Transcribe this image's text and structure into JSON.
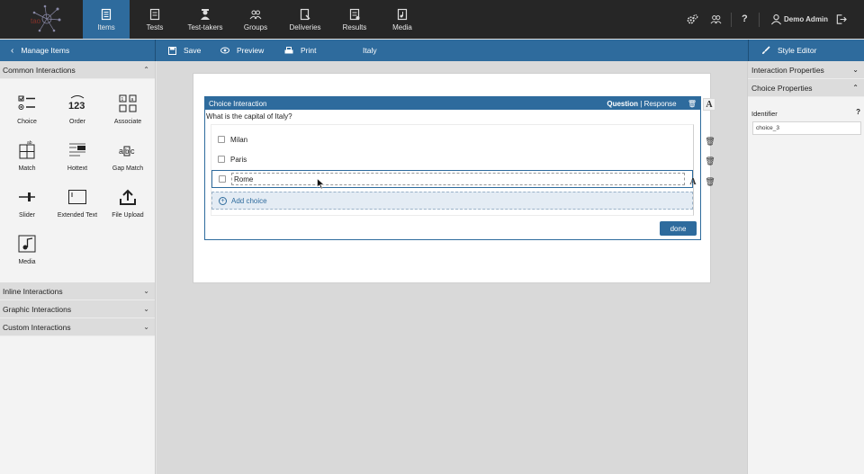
{
  "nav": {
    "tabs": [
      {
        "label": "Items",
        "icon": "items-icon",
        "active": true
      },
      {
        "label": "Tests",
        "icon": "tests-icon"
      },
      {
        "label": "Test-takers",
        "icon": "test-takers-icon"
      },
      {
        "label": "Groups",
        "icon": "groups-icon"
      },
      {
        "label": "Deliveries",
        "icon": "deliveries-icon"
      },
      {
        "label": "Results",
        "icon": "results-icon"
      },
      {
        "label": "Media",
        "icon": "media-icon"
      }
    ],
    "help": "?",
    "user": "Demo Admin"
  },
  "toolbar": {
    "manage_items": "Manage Items",
    "save": "Save",
    "preview": "Preview",
    "print": "Print",
    "item_title": "Italy",
    "style_editor": "Style Editor"
  },
  "left": {
    "common_header": "Common Interactions",
    "tools": [
      {
        "label": "Choice",
        "icon": "choice-icon"
      },
      {
        "label": "Order",
        "icon": "order-icon"
      },
      {
        "label": "Associate",
        "icon": "associate-icon"
      },
      {
        "label": "Match",
        "icon": "match-icon"
      },
      {
        "label": "Hottext",
        "icon": "hottext-icon"
      },
      {
        "label": "Gap Match",
        "icon": "gap-match-icon"
      },
      {
        "label": "Slider",
        "icon": "slider-icon"
      },
      {
        "label": "Extended Text",
        "icon": "extended-text-icon"
      },
      {
        "label": "File Upload",
        "icon": "file-upload-icon"
      },
      {
        "label": "Media",
        "icon": "media-icon"
      }
    ],
    "inline_header": "Inline Interactions",
    "graphic_header": "Graphic Interactions",
    "custom_header": "Custom Interactions"
  },
  "interaction": {
    "title": "Choice Interaction",
    "mode_question": "Question",
    "mode_sep": "|",
    "mode_response": "Response",
    "prompt": "What is the capital of Italy?",
    "choices": [
      "Milan",
      "Paris",
      "Rome"
    ],
    "add_choice": "Add choice",
    "done": "done"
  },
  "right": {
    "interaction_props": "Interaction Properties",
    "choice_props": "Choice Properties",
    "identifier_label": "Identifier",
    "help": "?",
    "identifier_value": "choice_3"
  },
  "colors": {
    "brand_blue": "#2e6b9d",
    "topbar": "#262626"
  }
}
